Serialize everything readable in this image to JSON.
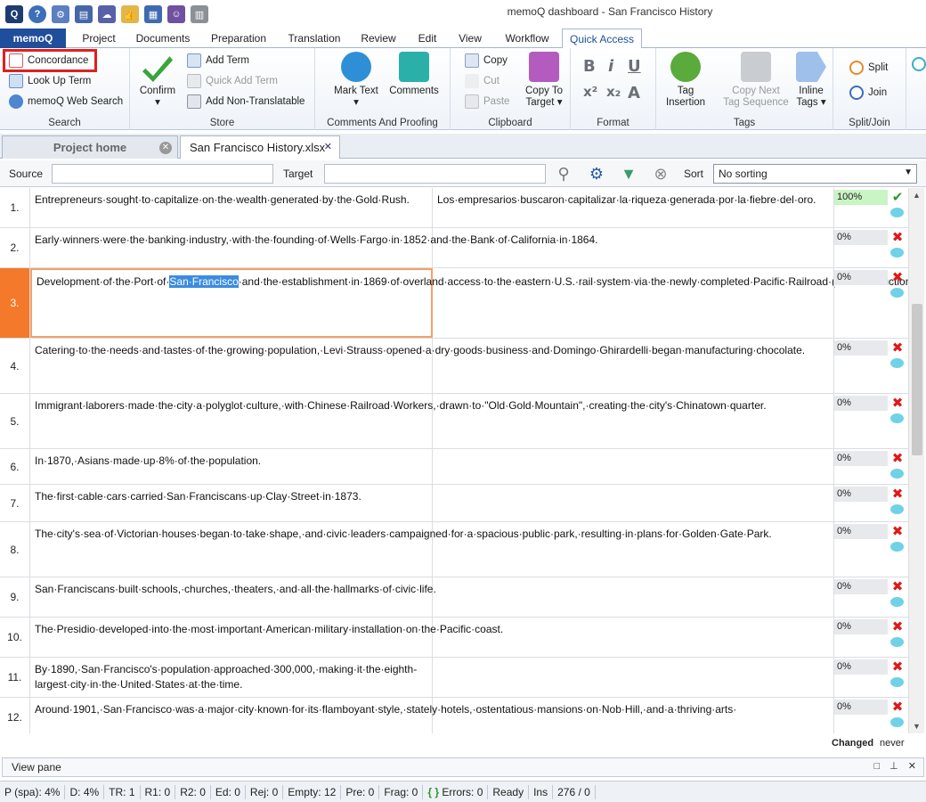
{
  "window": {
    "title": "memoQ dashboard - San Francisco History"
  },
  "tabs": {
    "app": "memoQ",
    "items": [
      "Project",
      "Documents",
      "Preparation",
      "Translation",
      "Review",
      "Edit",
      "View",
      "Workflow",
      "Quick Access"
    ],
    "active": "Quick Access"
  },
  "ribbon": {
    "search": {
      "concordance": "Concordance",
      "lookup": "Look Up Term",
      "websearch": "memoQ Web Search",
      "label": "Search"
    },
    "store": {
      "confirm": "Confirm",
      "add_term": "Add Term",
      "quick_add": "Quick Add Term",
      "add_nontrans": "Add Non-Translatable",
      "label": "Store"
    },
    "comments": {
      "mark_text": "Mark Text",
      "comments": "Comments",
      "label": "Comments And Proofing"
    },
    "clipboard": {
      "copy": "Copy",
      "cut": "Cut",
      "paste": "Paste",
      "copy_to_1": "Copy To",
      "copy_to_2": "Target",
      "label": "Clipboard"
    },
    "format": {
      "label": "Format"
    },
    "tags": {
      "tag_ins_1": "Tag",
      "tag_ins_2": "Insertion",
      "copy_next_1": "Copy Next",
      "copy_next_2": "Tag Sequence",
      "inline_1": "Inline",
      "inline_2": "Tags",
      "label": "Tags"
    },
    "splitjoin": {
      "split": "Split",
      "join": "Join",
      "label": "Split/Join"
    }
  },
  "doctabs": {
    "home": "Project home",
    "file": "San Francisco History.xlsx"
  },
  "filter": {
    "source_label": "Source",
    "target_label": "Target",
    "sort_label": "Sort",
    "sort_value": "No sorting"
  },
  "rows": [
    {
      "n": "1.",
      "src": "Entrepreneurs·sought·to·capitalize·on·the·wealth·generated·by·the·Gold·Rush.",
      "tgt": "Los·empresarios·buscaron·capitalizar·la·riqueza·generada·por·la·fiebre·del·oro.",
      "match": "100%",
      "status": "✔"
    },
    {
      "n": "2.",
      "src": "Early·winners·were·the·banking·industry,·with·the·founding·of·Wells·Fargo·in·1852·and·the·Bank·of·California·in·1864.",
      "tgt": "",
      "match": "0%",
      "status": "✖"
    },
    {
      "n": "3.",
      "src_pre": "Development·of·the·Port·of·",
      "src_hl": "San·Francisco",
      "src_post": "·and·the·establishment·in·1869·of·overland·access·to·the·eastern·U.S.·rail·system·via·the·newly·completed·Pacific·Railroad·(the·construction·of·which·the·city·only·reluctantly·helped·support)·helped·make·the·Bay·Area·a·center·for·trade.",
      "tgt": "",
      "match": "0%",
      "status": "✖"
    },
    {
      "n": "4.",
      "src": "Catering·to·the·needs·and·tastes·of·the·growing·population,·Levi·Strauss·opened·a·dry·goods·business·and·Domingo·Ghirardelli·began·manufacturing·chocolate.",
      "tgt": "",
      "match": "0%",
      "status": "✖"
    },
    {
      "n": "5.",
      "src": "Immigrant·laborers·made·the·city·a·polyglot·culture,·with·Chinese·Railroad·Workers,·drawn·to·\"Old·Gold·Mountain\",·creating·the·city's·Chinatown·quarter.",
      "tgt": "",
      "match": "0%",
      "status": "✖"
    },
    {
      "n": "6.",
      "src": "In·1870,·Asians·made·up·8%·of·the·population.",
      "tgt": "",
      "match": "0%",
      "status": "✖"
    },
    {
      "n": "7.",
      "src": "The·first·cable·cars·carried·San·Franciscans·up·Clay·Street·in·1873.",
      "tgt": "",
      "match": "0%",
      "status": "✖"
    },
    {
      "n": "8.",
      "src": "The·city's·sea·of·Victorian·houses·began·to·take·shape,·and·civic·leaders·campaigned·for·a·spacious·public·park,·resulting·in·plans·for·Golden·Gate·Park.",
      "tgt": "",
      "match": "0%",
      "status": "✖"
    },
    {
      "n": "9.",
      "src": "San·Franciscans·built·schools,·churches,·theaters,·and·all·the·hallmarks·of·civic·life.",
      "tgt": "",
      "match": "0%",
      "status": "✖"
    },
    {
      "n": "10.",
      "src": "The·Presidio·developed·into·the·most·important·American·military·installation·on·the·Pacific·coast.",
      "tgt": "",
      "match": "0%",
      "status": "✖"
    },
    {
      "n": "11.",
      "src": "By·1890,·San·Francisco's·population·approached·300,000,·making·it·the·eighth-largest·city·in·the·United·States·at·the·time.",
      "tgt": "",
      "match": "0%",
      "status": "✖"
    },
    {
      "n": "12.",
      "src": "Around·1901,·San·Francisco·was·a·major·city·known·for·its·flamboyant·style,·stately·hotels,·ostentatious·mansions·on·Nob·Hill,·and·a·thriving·arts·",
      "tgt": "",
      "match": "0%",
      "status": "✖"
    }
  ],
  "changed": {
    "label": "Changed",
    "value": "never"
  },
  "viewpane": {
    "label": "View pane"
  },
  "status": [
    "P (spa): 4%",
    "D: 4%",
    "TR: 1",
    "R1: 0",
    "R2: 0",
    "Ed: 0",
    "Rej: 0",
    "Empty: 12",
    "Pre: 0",
    "Frag: 0",
    "Errors: 0",
    "Ready",
    "Ins",
    "276 / 0"
  ]
}
